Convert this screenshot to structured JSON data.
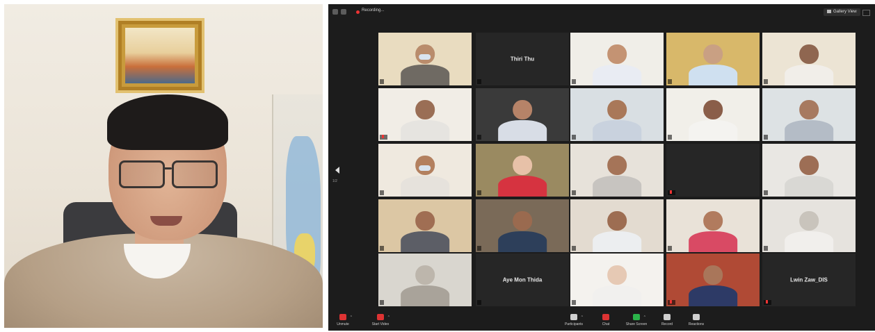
{
  "zoom": {
    "top_left_icons": [
      "info-icon",
      "shield-icon"
    ],
    "recording_label": "Recording...",
    "view_button": "Gallery View",
    "page_indicator": "1/2",
    "tiles": [
      {
        "name": "",
        "center_text": "",
        "muted": false,
        "bg": "#e9dcc0",
        "skin": "#b98c6c",
        "shirt": "#6f6a63",
        "mask": true
      },
      {
        "name": "",
        "center_text": "Thiri Thu",
        "muted": false,
        "video": false
      },
      {
        "name": "",
        "center_text": "",
        "muted": false,
        "bg": "#f0eee8",
        "skin": "#c49373",
        "shirt": "#e9ecf3"
      },
      {
        "name": "",
        "center_text": "",
        "muted": false,
        "bg": "#d8b86a",
        "skin": "#c9a083",
        "shirt": "#cfe0f0"
      },
      {
        "name": "",
        "center_text": "",
        "muted": false,
        "bg": "#ece4d4",
        "skin": "#8f6650",
        "shirt": "#f1eee9"
      },
      {
        "name": "",
        "center_text": "",
        "muted": true,
        "bg": "#f1ede6",
        "skin": "#9a6e55",
        "shirt": "#e6e4e0"
      },
      {
        "name": "",
        "center_text": "",
        "muted": false,
        "bg": "#3a3a3a",
        "skin": "#b68368",
        "shirt": "#d8dde6"
      },
      {
        "name": "",
        "center_text": "",
        "muted": false,
        "bg": "#d9dfe3",
        "skin": "#a97859",
        "shirt": "#c9d2de"
      },
      {
        "name": "",
        "center_text": "",
        "muted": false,
        "bg": "#f1efe9",
        "skin": "#8a5e49",
        "shirt": "#f4f3f0"
      },
      {
        "name": "",
        "center_text": "",
        "muted": false,
        "bg": "#dde2e4",
        "skin": "#a77a60",
        "shirt": "#b4bcc6"
      },
      {
        "name": "",
        "center_text": "",
        "muted": false,
        "bg": "#efe9df",
        "skin": "#b3805f",
        "shirt": "#e6e2dc",
        "mask": true
      },
      {
        "name": "",
        "center_text": "",
        "muted": false,
        "bg": "#9a8a61",
        "skin": "#e7c1a8",
        "shirt": "#d63340"
      },
      {
        "name": "",
        "center_text": "",
        "muted": false,
        "bg": "#e7e2da",
        "skin": "#a57458",
        "shirt": "#c7c4c0"
      },
      {
        "name": "",
        "center_text": "",
        "muted": true,
        "video": false
      },
      {
        "name": "",
        "center_text": "",
        "muted": false,
        "bg": "#e9e7e3",
        "skin": "#9d6e55",
        "shirt": "#d9d8d4"
      },
      {
        "name": "",
        "center_text": "",
        "muted": false,
        "bg": "#dcc7a4",
        "skin": "#a06e53",
        "shirt": "#5c5e66"
      },
      {
        "name": "",
        "center_text": "",
        "muted": false,
        "bg": "#7a6a58",
        "skin": "#9a6a4f",
        "shirt": "#2d3f5a"
      },
      {
        "name": "",
        "center_text": "",
        "muted": false,
        "bg": "#e3dbd0",
        "skin": "#9d6d52",
        "shirt": "#eceef0"
      },
      {
        "name": "",
        "center_text": "",
        "muted": false,
        "bg": "#e9e2d8",
        "skin": "#b17b5e",
        "shirt": "#d94a64"
      },
      {
        "name": "",
        "center_text": "",
        "muted": false,
        "bg": "#e6e3de",
        "skin": "#c9c4bc",
        "shirt": "#f1efec"
      },
      {
        "name": "",
        "center_text": "",
        "muted": false,
        "bg": "#d9d6cf",
        "skin": "#bdb6ac",
        "shirt": "#a9a39a"
      },
      {
        "name": "",
        "center_text": "Aye Mon Thida",
        "muted": false,
        "video": false
      },
      {
        "name": "",
        "center_text": "",
        "muted": false,
        "bg": "#f4f2ee",
        "skin": "#e6c9b4",
        "shirt": "#f1f0ee"
      },
      {
        "name": "",
        "center_text": "",
        "muted": true,
        "bg": "#b04a35",
        "skin": "#a9765a",
        "shirt": "#2d3a66"
      },
      {
        "name": "",
        "center_text": "Lwin Zaw_DIS",
        "muted": true,
        "video": false
      }
    ],
    "toolbar": [
      {
        "label": "Unmute",
        "icon": "mic-muted-icon",
        "style": "red",
        "caret": true
      },
      {
        "label": "Start Video",
        "icon": "video-off-icon",
        "style": "red",
        "caret": true
      },
      {
        "label": "Participants",
        "icon": "participants-icon",
        "style": "",
        "caret": true
      },
      {
        "label": "Chat",
        "icon": "chat-icon",
        "style": "red",
        "caret": false
      },
      {
        "label": "Share Screen",
        "icon": "share-screen-icon",
        "style": "green",
        "caret": true
      },
      {
        "label": "Record",
        "icon": "record-icon",
        "style": "",
        "caret": false
      },
      {
        "label": "Reactions",
        "icon": "reactions-icon",
        "style": "",
        "caret": false
      }
    ]
  }
}
